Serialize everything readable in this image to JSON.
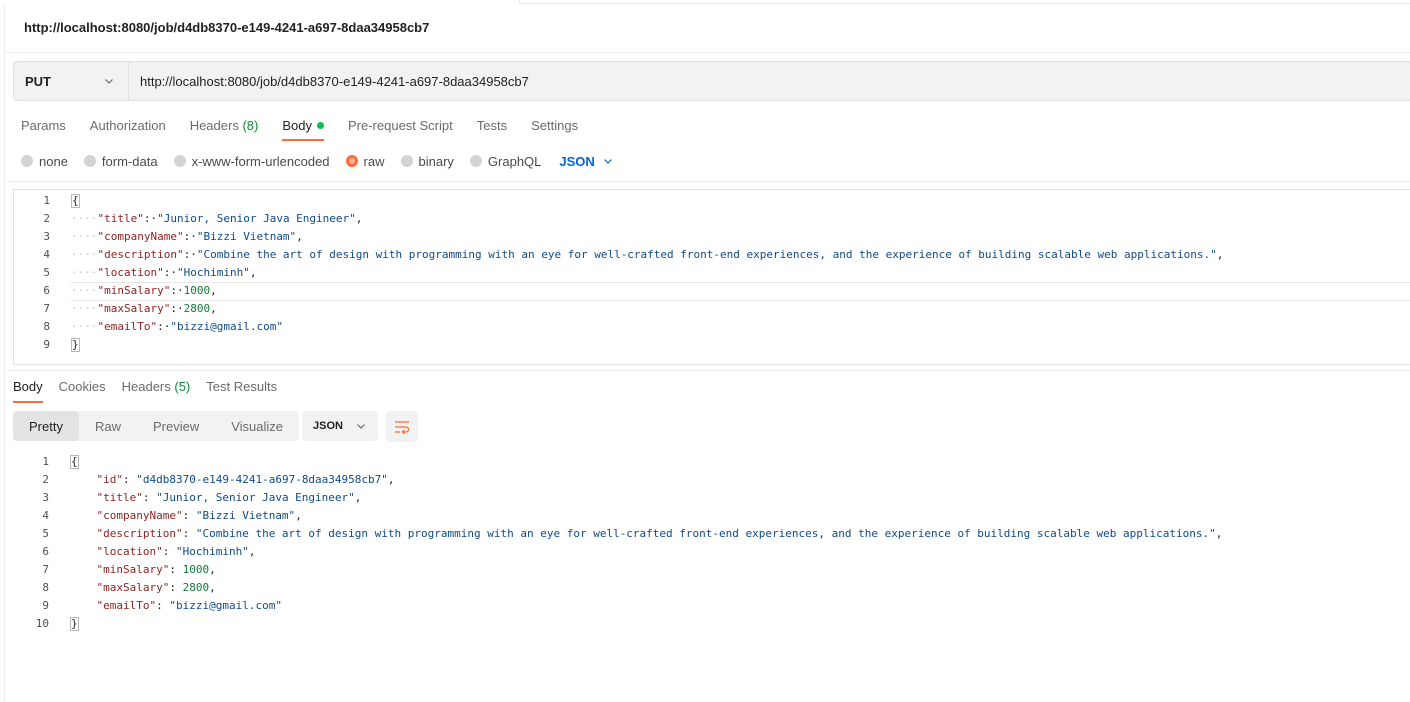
{
  "request": {
    "title": "http://localhost:8080/job/d4db8370-e149-4241-a697-8daa34958cb7",
    "method": "PUT",
    "url": "http://localhost:8080/job/d4db8370-e149-4241-a697-8daa34958cb7"
  },
  "request_tabs": [
    {
      "label": "Params"
    },
    {
      "label": "Authorization"
    },
    {
      "label": "Headers",
      "count": "(8)"
    },
    {
      "label": "Body",
      "active": true
    },
    {
      "label": "Pre-request Script"
    },
    {
      "label": "Tests"
    },
    {
      "label": "Settings"
    }
  ],
  "body_types": [
    {
      "label": "none"
    },
    {
      "label": "form-data"
    },
    {
      "label": "x-www-form-urlencoded"
    },
    {
      "label": "raw",
      "checked": true
    },
    {
      "label": "binary"
    },
    {
      "label": "GraphQL"
    }
  ],
  "body_language": "JSON",
  "request_body_lines": [
    {
      "n": "1",
      "text": "{"
    },
    {
      "n": "2",
      "key": "\"title\"",
      "value": "\"Junior, Senior Java Engineer\"",
      "vtype": "s",
      "comma": true
    },
    {
      "n": "3",
      "key": "\"companyName\"",
      "value": "\"Bizzi Vietnam\"",
      "vtype": "s",
      "comma": true
    },
    {
      "n": "4",
      "key": "\"description\"",
      "value": "\"Combine the art of design with programming with an eye for well-crafted front-end experiences, and the experience of building scalable web applications.\"",
      "vtype": "s",
      "comma": true
    },
    {
      "n": "5",
      "key": "\"location\"",
      "value": "\"Hochiminh\"",
      "vtype": "s",
      "comma": true
    },
    {
      "n": "6",
      "key": "\"minSalary\"",
      "value": "1000",
      "vtype": "n",
      "comma": true
    },
    {
      "n": "7",
      "key": "\"maxSalary\"",
      "value": "2800",
      "vtype": "n",
      "comma": true
    },
    {
      "n": "8",
      "key": "\"emailTo\"",
      "value": "\"bizzi@gmail.com\"",
      "vtype": "s",
      "comma": false
    },
    {
      "n": "9",
      "text": "}"
    }
  ],
  "response_tabs": [
    {
      "label": "Body",
      "active": true
    },
    {
      "label": "Cookies"
    },
    {
      "label": "Headers",
      "count": "(5)"
    },
    {
      "label": "Test Results"
    }
  ],
  "response_views": [
    {
      "label": "Pretty",
      "active": true
    },
    {
      "label": "Raw"
    },
    {
      "label": "Preview"
    },
    {
      "label": "Visualize"
    }
  ],
  "response_format": "JSON",
  "response_body_lines": [
    {
      "n": "1",
      "text": "{"
    },
    {
      "n": "2",
      "key": "\"id\"",
      "value": "\"d4db8370-e149-4241-a697-8daa34958cb7\"",
      "vtype": "s",
      "comma": true
    },
    {
      "n": "3",
      "key": "\"title\"",
      "value": "\"Junior, Senior Java Engineer\"",
      "vtype": "s",
      "comma": true
    },
    {
      "n": "4",
      "key": "\"companyName\"",
      "value": "\"Bizzi Vietnam\"",
      "vtype": "s",
      "comma": true
    },
    {
      "n": "5",
      "key": "\"description\"",
      "value": "\"Combine the art of design with programming with an eye for well-crafted front-end experiences, and the experience of building scalable web applications.\"",
      "vtype": "s",
      "comma": true
    },
    {
      "n": "6",
      "key": "\"location\"",
      "value": "\"Hochiminh\"",
      "vtype": "s",
      "comma": true
    },
    {
      "n": "7",
      "key": "\"minSalary\"",
      "value": "1000",
      "vtype": "n",
      "comma": true
    },
    {
      "n": "8",
      "key": "\"maxSalary\"",
      "value": "2800",
      "vtype": "n",
      "comma": true
    },
    {
      "n": "9",
      "key": "\"emailTo\"",
      "value": "\"bizzi@gmail.com\"",
      "vtype": "s",
      "comma": false
    },
    {
      "n": "10",
      "text": "}"
    }
  ],
  "colors": {
    "accent": "#ff6c37",
    "success": "#0cbb52",
    "link": "#0265d2",
    "json_key": "#8e1f1f",
    "json_string": "#0e4a8a",
    "json_number": "#117a3d"
  }
}
